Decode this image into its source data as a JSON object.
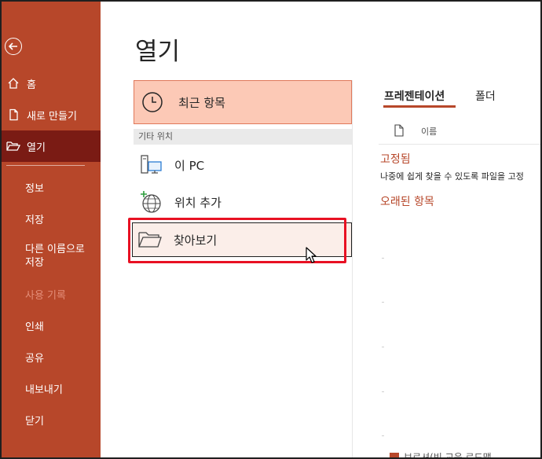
{
  "sidebar": {
    "back_label": "back",
    "top_items": [
      {
        "label": "홈",
        "icon": "home-icon"
      },
      {
        "label": "새로 만들기",
        "icon": "new-file-icon"
      },
      {
        "label": "열기",
        "icon": "folder-open-icon",
        "active": true
      }
    ],
    "bottom_items": [
      {
        "label": "정보"
      },
      {
        "label": "저장"
      },
      {
        "label": "다른 이름으로\n저장"
      },
      {
        "label": "사용 기록",
        "disabled": true
      },
      {
        "label": "인쇄"
      },
      {
        "label": "공유"
      },
      {
        "label": "내보내기"
      },
      {
        "label": "닫기"
      }
    ]
  },
  "main": {
    "title": "열기",
    "recent_label": "최근 항목",
    "other_locations_header": "기타 위치",
    "this_pc_label": "이 PC",
    "add_location_label": "위치 추가",
    "browse_label": "찾아보기"
  },
  "right_panel": {
    "tabs": [
      "프레젠테이션",
      "폴더"
    ],
    "name_column": "이름",
    "pinned_header": "고정됨",
    "pinned_hint": "나중에 쉽게 찾을 수 있도록 파일을 고정",
    "older_header": "오래된 항목",
    "bottom_text": "브로셔(빈 교육 로드맵"
  },
  "colors": {
    "accent": "#b7472a",
    "active_nav": "#7a1b14",
    "recent_tile_bg": "#fcc9b6",
    "highlight": "#e81123"
  }
}
